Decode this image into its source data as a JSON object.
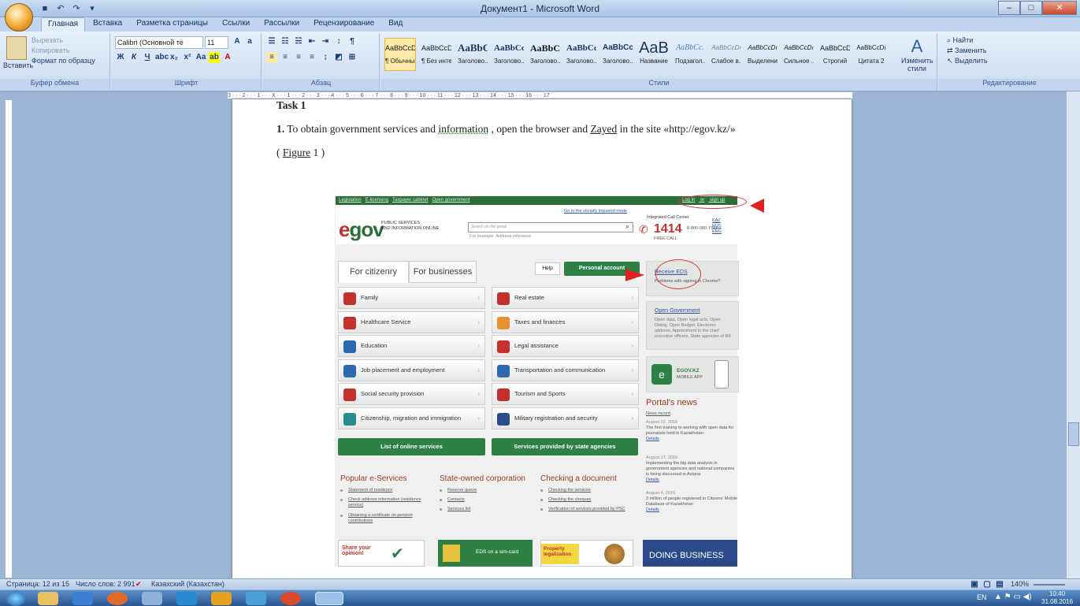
{
  "window": {
    "title": "Документ1 - Microsoft Word",
    "minimize": "–",
    "maximize": "□",
    "close": "✕"
  },
  "ribbon": {
    "tabs": [
      "Главная",
      "Вставка",
      "Разметка страницы",
      "Ссылки",
      "Рассылки",
      "Рецензирование",
      "Вид"
    ],
    "clipboard": {
      "paste": "Вставить",
      "cut": "Вырезать",
      "copy": "Копировать",
      "format_painter": "Формат по образцу",
      "label": "Буфер обмена"
    },
    "font": {
      "family": "Calibri (Основной те",
      "size": "11",
      "label": "Шрифт"
    },
    "paragraph": {
      "label": "Абзац"
    },
    "styles": {
      "label": "Стили",
      "change": "Изменить стили",
      "items": [
        {
          "preview": "AaBbCcDc",
          "name": "¶ Обычный",
          "selected": true
        },
        {
          "preview": "AaBbCcDc",
          "name": "¶ Без инте..."
        },
        {
          "preview": "AaBbC",
          "name": "Заголово..."
        },
        {
          "preview": "AaBbCc",
          "name": "Заголово..."
        },
        {
          "preview": "AaBbC",
          "name": "Заголово..."
        },
        {
          "preview": "AaBbCcl",
          "name": "Заголово..."
        },
        {
          "preview": "AaBbCcD",
          "name": "Заголово..."
        },
        {
          "preview": "AaB",
          "name": "Название"
        },
        {
          "preview": "AaBbCc.",
          "name": "Подзагол..."
        },
        {
          "preview": "AaBbCcDı",
          "name": "Слабое в..."
        },
        {
          "preview": "AaBbCcDı",
          "name": "Выделение"
        },
        {
          "preview": "AaBbCcDı",
          "name": "Сильное ..."
        },
        {
          "preview": "AaBbCcDc",
          "name": "Строгий"
        },
        {
          "preview": "AaBbCcDı",
          "name": "Цитата 2"
        }
      ]
    },
    "editing": {
      "find": "Найти",
      "replace": "Заменить",
      "select": "Выделить",
      "label": "Редактирование"
    }
  },
  "ruler": "3 · · · 2 · · · 1 · · · X · · · 1 · · · 2 · · · 3 · · · 4 · · · 5 · · · 6 · · · 7 · · · 8 · · · 9 · · · 10 · · · 11 · · · 12 · · · 13 · · · 14 · · · 15 · · · 16 · · · 17",
  "document": {
    "heading": "Task 1",
    "paragraph_number": "1.",
    "p1_before": " To obtain government services and ",
    "p1_info": "information",
    "p1_middle": " , open the browser and ",
    "p1_zayed": "Zayed",
    "p1_after": " in the site «http://egov.kz/»",
    "figure_open": "( ",
    "figure_word": "Figure",
    "figure_close": " 1 )"
  },
  "egov": {
    "toplinks": [
      "Legislation",
      "E-licensing",
      "Taxpayer cabinet",
      "Open government"
    ],
    "login": "Log in",
    "or": "or",
    "signup": "sign up",
    "visually_impaired": "Go to the visually impaired mode",
    "logo_e": "e",
    "logo_gov": "gov",
    "logo_sub1": "PUBLIC SERVICES",
    "logo_sub2": "AND INFORMATION ONLINE",
    "search_placeholder": "Search on the portal",
    "search_example": "For example: Address reference",
    "call_center": "Integrated Call Center",
    "hotline": "1414",
    "hotline_alt": "8-800-080-7777",
    "free": "FREE CALL",
    "langs": [
      "KAZ",
      "RUS",
      "ENG"
    ],
    "tab_citizen": "For citizenry",
    "tab_business": "For businesses",
    "help": "Help",
    "personal_account": "Personal account",
    "categories_left": [
      "Family",
      "Healthcare Service",
      "Education",
      "Job placement and employment",
      "Social security provision",
      "Citizenship, migration and immigration"
    ],
    "categories_right": [
      "Real estate",
      "Taxes and finances",
      "Legal assistance",
      "Transportation and communication",
      "Tourism and Sports",
      "Military registration and security"
    ],
    "list_services": "List of online services",
    "state_services": "Services provided by state agencies",
    "receive_eds": "Receive EDS",
    "eds_sub": "Problems with signing in Chrome?",
    "open_gov": "Open Government",
    "open_gov_text": "Open data, Open legal acts, Open Dialog, Open Budget, Electronic address, Appointment to the chief executive officers, State agencies of RK",
    "app_title": "EGOV.KZ",
    "app_sub": "MOBILE APP",
    "news_title": "Portal's news",
    "news_archive": "News record",
    "news": [
      {
        "date": "August 22, 2016",
        "text": "The first training to working with open data for journalists held in Kazakhstan",
        "more": "Details"
      },
      {
        "date": "August 17, 2016",
        "text": "Implementing the big data analysis in government agencies and national companies is being discussed in Astana",
        "more": "Details"
      },
      {
        "date": "August 4, 2016",
        "text": "3 million of people registered in Citizens' Mobile Database of Kazakhstan",
        "more": "Details"
      }
    ],
    "popular_title": "Popular e-Services",
    "popular": [
      "Statement of residence",
      "Check address information (residence service)",
      "Obtaining a certificate on pension contributions"
    ],
    "corp_title": "State-owned corporation",
    "corp": [
      "Reserve queue",
      "Contacts",
      "Services list"
    ],
    "check_title": "Checking a document",
    "check": [
      "Checking the services",
      "Checking the cheques",
      "Verification of services provided by PSC"
    ],
    "banner1": "Share your opinion!",
    "banner2": "EDS on a sim-card",
    "banner3": "Property legalization",
    "banner4": "DOING BUSINESS"
  },
  "status": {
    "page": "Страница: 12 из 15",
    "words": "Число слов: 2 991",
    "lang": "Казахский (Казахстан)",
    "zoom": "140%"
  },
  "tray": {
    "lang": "EN",
    "time": "10:40",
    "date": "31.08.2016"
  }
}
